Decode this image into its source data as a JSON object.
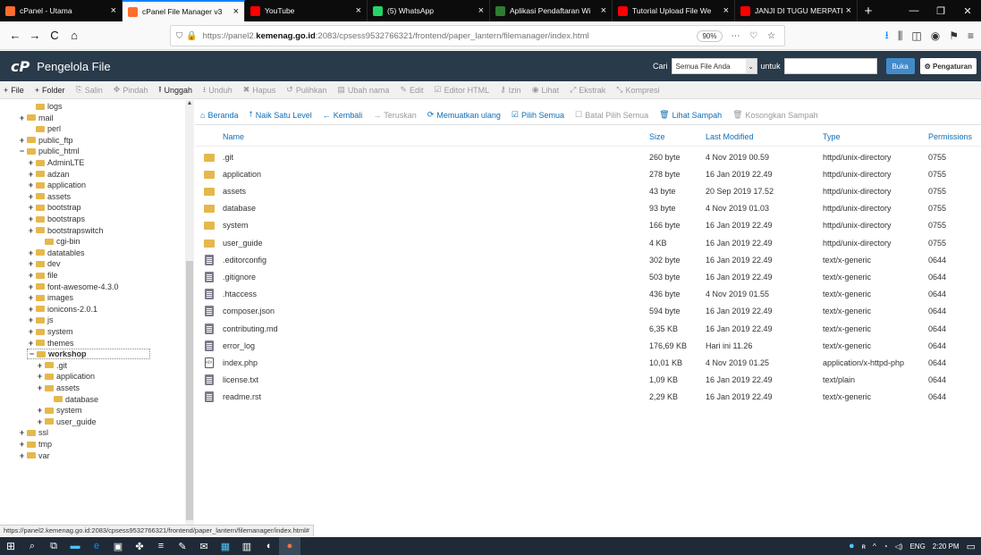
{
  "tabs": [
    {
      "label": "cPanel - Utama",
      "icon": "cpanel-icon",
      "color": "#ff6c2c",
      "active": false
    },
    {
      "label": "cPanel File Manager v3",
      "icon": "cpanel-icon",
      "color": "#ff6c2c",
      "active": true
    },
    {
      "label": "YouTube",
      "icon": "youtube-icon",
      "color": "#ff0000",
      "active": false
    },
    {
      "label": "(5) WhatsApp",
      "icon": "whatsapp-icon",
      "color": "#25d366",
      "active": false
    },
    {
      "label": "Aplikasi Pendaftaran Wi",
      "icon": "site-icon",
      "color": "#2e7d32",
      "active": false
    },
    {
      "label": "Tutorial Upload File We",
      "icon": "youtube-icon",
      "color": "#ff0000",
      "active": false
    },
    {
      "label": "JANJI DI TUGU MERPATI",
      "icon": "youtube-icon",
      "color": "#ff0000",
      "active": false
    }
  ],
  "url": {
    "prefix": "https://panel2.",
    "domain": "kemenag.go.id",
    "suffix": ":2083/cpsess9532766321/frontend/paper_lantern/filemanager/index.html",
    "zoom": "90%"
  },
  "cpanel": {
    "logo": "cP",
    "title": "Pengelola File",
    "search_label": "Cari",
    "scope": "Semua File Anda",
    "for_label": "untuk",
    "go": "Buka",
    "settings": "Pengaturan"
  },
  "toolbar": [
    {
      "label": "File",
      "icon": "+",
      "on": true
    },
    {
      "label": "Folder",
      "icon": "+",
      "on": true
    },
    {
      "label": "Salin",
      "icon": "⎘",
      "on": false
    },
    {
      "label": "Pindah",
      "icon": "✥",
      "on": false
    },
    {
      "label": "Unggah",
      "icon": "⭱",
      "on": true
    },
    {
      "label": "Unduh",
      "icon": "⭳",
      "on": false
    },
    {
      "label": "Hapus",
      "icon": "✖",
      "on": false
    },
    {
      "label": "Pulihkan",
      "icon": "↺",
      "on": false
    },
    {
      "label": "Ubah nama",
      "icon": "▤",
      "on": false
    },
    {
      "label": "Edit",
      "icon": "✎",
      "on": false
    },
    {
      "label": "Editor HTML",
      "icon": "☑",
      "on": false
    },
    {
      "label": "Izin",
      "icon": "⚷",
      "on": false
    },
    {
      "label": "Lihat",
      "icon": "◉",
      "on": false
    },
    {
      "label": "Ekstrak",
      "icon": "⤢",
      "on": false
    },
    {
      "label": "Kompresi",
      "icon": "⤡",
      "on": false
    }
  ],
  "navrow": [
    {
      "label": "Beranda",
      "icon": "⌂",
      "on": true
    },
    {
      "label": "Naik Satu Level",
      "icon": "⭡",
      "on": true
    },
    {
      "label": "Kembali",
      "icon": "←",
      "on": true
    },
    {
      "label": "Teruskan",
      "icon": "→",
      "on": false
    },
    {
      "label": "Memuatkan ulang",
      "icon": "⟳",
      "on": true
    },
    {
      "label": "Pilih Semua",
      "icon": "☑",
      "on": true
    },
    {
      "label": "Batal Pilih Semua",
      "icon": "☐",
      "on": false
    },
    {
      "label": "Lihat Sampah",
      "icon": "🗑",
      "on": true
    },
    {
      "label": "Kosongkan Sampah",
      "icon": "🗑",
      "on": false
    }
  ],
  "columns": {
    "name": "Name",
    "size": "Size",
    "modified": "Last Modified",
    "type": "Type",
    "perm": "Permissions"
  },
  "files": [
    {
      "name": ".git",
      "size": "260 byte",
      "modified": "4 Nov 2019 00.59",
      "type": "httpd/unix-directory",
      "perm": "0755",
      "kind": "folder"
    },
    {
      "name": "application",
      "size": "278 byte",
      "modified": "16 Jan 2019 22.49",
      "type": "httpd/unix-directory",
      "perm": "0755",
      "kind": "folder"
    },
    {
      "name": "assets",
      "size": "43 byte",
      "modified": "20 Sep 2019 17.52",
      "type": "httpd/unix-directory",
      "perm": "0755",
      "kind": "folder"
    },
    {
      "name": "database",
      "size": "93 byte",
      "modified": "4 Nov 2019 01.03",
      "type": "httpd/unix-directory",
      "perm": "0755",
      "kind": "folder"
    },
    {
      "name": "system",
      "size": "166 byte",
      "modified": "16 Jan 2019 22.49",
      "type": "httpd/unix-directory",
      "perm": "0755",
      "kind": "folder"
    },
    {
      "name": "user_guide",
      "size": "4 KB",
      "modified": "16 Jan 2019 22.49",
      "type": "httpd/unix-directory",
      "perm": "0755",
      "kind": "folder"
    },
    {
      "name": ".editorconfig",
      "size": "302 byte",
      "modified": "16 Jan 2019 22.49",
      "type": "text/x-generic",
      "perm": "0644",
      "kind": "file"
    },
    {
      "name": ".gitignore",
      "size": "503 byte",
      "modified": "16 Jan 2019 22.49",
      "type": "text/x-generic",
      "perm": "0644",
      "kind": "file"
    },
    {
      "name": ".htaccess",
      "size": "436 byte",
      "modified": "4 Nov 2019 01.55",
      "type": "text/x-generic",
      "perm": "0644",
      "kind": "file"
    },
    {
      "name": "composer.json",
      "size": "594 byte",
      "modified": "16 Jan 2019 22.49",
      "type": "text/x-generic",
      "perm": "0644",
      "kind": "file"
    },
    {
      "name": "contributing.md",
      "size": "6,35 KB",
      "modified": "16 Jan 2019 22.49",
      "type": "text/x-generic",
      "perm": "0644",
      "kind": "file"
    },
    {
      "name": "error_log",
      "size": "176,69 KB",
      "modified": "Hari ini 11.26",
      "type": "text/x-generic",
      "perm": "0644",
      "kind": "file"
    },
    {
      "name": "index.php",
      "size": "10,01 KB",
      "modified": "4 Nov 2019 01.25",
      "type": "application/x-httpd-php",
      "perm": "0644",
      "kind": "php"
    },
    {
      "name": "license.txt",
      "size": "1,09 KB",
      "modified": "16 Jan 2019 22.49",
      "type": "text/plain",
      "perm": "0644",
      "kind": "file"
    },
    {
      "name": "readme.rst",
      "size": "2,29 KB",
      "modified": "16 Jan 2019 22.49",
      "type": "text/x-generic",
      "perm": "0644",
      "kind": "file"
    }
  ],
  "tree": [
    {
      "label": "logs",
      "depth": 2,
      "toggle": ""
    },
    {
      "label": "mail",
      "depth": 1,
      "toggle": "+"
    },
    {
      "label": "perl",
      "depth": 2,
      "toggle": ""
    },
    {
      "label": "public_ftp",
      "depth": 1,
      "toggle": "+"
    },
    {
      "label": "public_html",
      "depth": 1,
      "toggle": "−"
    },
    {
      "label": "AdminLTE",
      "depth": 2,
      "toggle": "+"
    },
    {
      "label": "adzan",
      "depth": 2,
      "toggle": "+"
    },
    {
      "label": "application",
      "depth": 2,
      "toggle": "+"
    },
    {
      "label": "assets",
      "depth": 2,
      "toggle": "+"
    },
    {
      "label": "bootstrap",
      "depth": 2,
      "toggle": "+"
    },
    {
      "label": "bootstraps",
      "depth": 2,
      "toggle": "+"
    },
    {
      "label": "bootstrapswitch",
      "depth": 2,
      "toggle": "+"
    },
    {
      "label": "cgi-bin",
      "depth": 3,
      "toggle": ""
    },
    {
      "label": "datatables",
      "depth": 2,
      "toggle": "+"
    },
    {
      "label": "dev",
      "depth": 2,
      "toggle": "+"
    },
    {
      "label": "file",
      "depth": 2,
      "toggle": "+"
    },
    {
      "label": "font-awesome-4.3.0",
      "depth": 2,
      "toggle": "+"
    },
    {
      "label": "images",
      "depth": 2,
      "toggle": "+"
    },
    {
      "label": "ionicons-2.0.1",
      "depth": 2,
      "toggle": "+"
    },
    {
      "label": "js",
      "depth": 2,
      "toggle": "+"
    },
    {
      "label": "system",
      "depth": 2,
      "toggle": "+"
    },
    {
      "label": "themes",
      "depth": 2,
      "toggle": "+"
    },
    {
      "label": "workshop",
      "depth": 2,
      "toggle": "−",
      "current": true
    },
    {
      "label": ".git",
      "depth": 3,
      "toggle": "+"
    },
    {
      "label": "application",
      "depth": 3,
      "toggle": "+"
    },
    {
      "label": "assets",
      "depth": 3,
      "toggle": "+"
    },
    {
      "label": "database",
      "depth": 4,
      "toggle": ""
    },
    {
      "label": "system",
      "depth": 3,
      "toggle": "+"
    },
    {
      "label": "user_guide",
      "depth": 3,
      "toggle": "+"
    },
    {
      "label": "ssl",
      "depth": 1,
      "toggle": "+"
    },
    {
      "label": "tmp",
      "depth": 1,
      "toggle": "+"
    },
    {
      "label": "var",
      "depth": 1,
      "toggle": "+"
    }
  ],
  "status_url": "https://panel2.kemenag.go.id:2083/cpsess9532766321/frontend/paper_lantern/filemanager/index.html#",
  "tray": {
    "lang": "ENG",
    "time": "2:20 PM"
  }
}
